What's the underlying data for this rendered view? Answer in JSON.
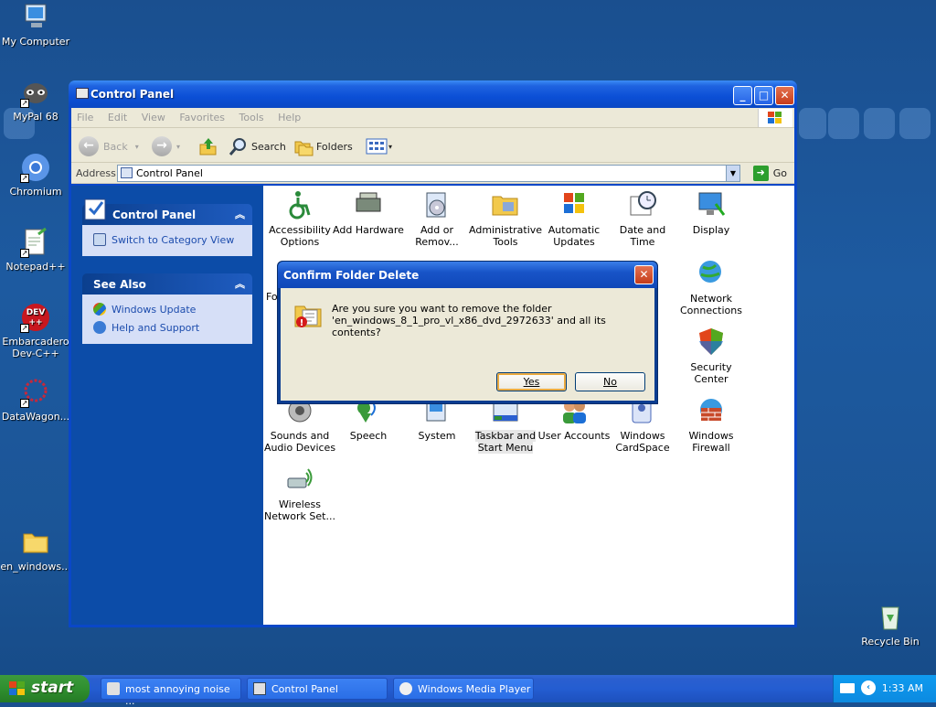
{
  "desktop": {
    "icons": [
      {
        "label": "My Computer"
      },
      {
        "label": "MyPal 68"
      },
      {
        "label": "Chromium"
      },
      {
        "label": "Notepad++"
      },
      {
        "label": "Embarcadero Dev-C++",
        "glyph": "DEV\n++"
      },
      {
        "label": "DataWagon..."
      },
      {
        "label": "en_windows..."
      },
      {
        "label": "Recycle Bin"
      }
    ]
  },
  "window": {
    "title": "Control Panel",
    "menu": [
      "File",
      "Edit",
      "View",
      "Favorites",
      "Tools",
      "Help"
    ],
    "toolbar": {
      "back": "Back",
      "search": "Search",
      "folders": "Folders"
    },
    "address": {
      "label": "Address",
      "value": "Control Panel",
      "go": "Go"
    },
    "left_panels": [
      {
        "title": "Control Panel",
        "items": [
          "Switch to Category View"
        ]
      },
      {
        "title": "See Also",
        "items": [
          "Windows Update",
          "Help and Support"
        ]
      }
    ],
    "items": [
      {
        "label": "Accessibility Options"
      },
      {
        "label": "Add Hardware"
      },
      {
        "label": "Add or Remov..."
      },
      {
        "label": "Administrative Tools"
      },
      {
        "label": "Automatic Updates"
      },
      {
        "label": "Date and Time"
      },
      {
        "label": "Display"
      },
      {
        "label": "Network Connections"
      },
      {
        "label": "Security Center"
      },
      {
        "label": "Sounds and Audio Devices"
      },
      {
        "label": "Speech"
      },
      {
        "label": "System"
      },
      {
        "label": "Taskbar and Start Menu"
      },
      {
        "label": "User Accounts"
      },
      {
        "label": "Windows CardSpace"
      },
      {
        "label": "Windows Firewall"
      },
      {
        "label": "Wireless Network Set..."
      },
      {
        "label": "Fo"
      }
    ]
  },
  "dialog": {
    "title": "Confirm Folder Delete",
    "line1": "Are you sure you want to remove the folder",
    "line2": "'en_windows_8_1_pro_vl_x86_dvd_2972633' and all its contents?",
    "yes": "Yes",
    "no": "No"
  },
  "taskbar": {
    "start": "start",
    "items": [
      {
        "label": "most annoying noise ..."
      },
      {
        "label": "Control Panel"
      },
      {
        "label": "Windows Media Player"
      }
    ],
    "clock": "1:33 AM"
  },
  "colors": {
    "desktop": "#1d5aa0",
    "window_frame": "#0a47c8",
    "start_green": "#2f8f2f",
    "close_red": "#c83d1b"
  }
}
